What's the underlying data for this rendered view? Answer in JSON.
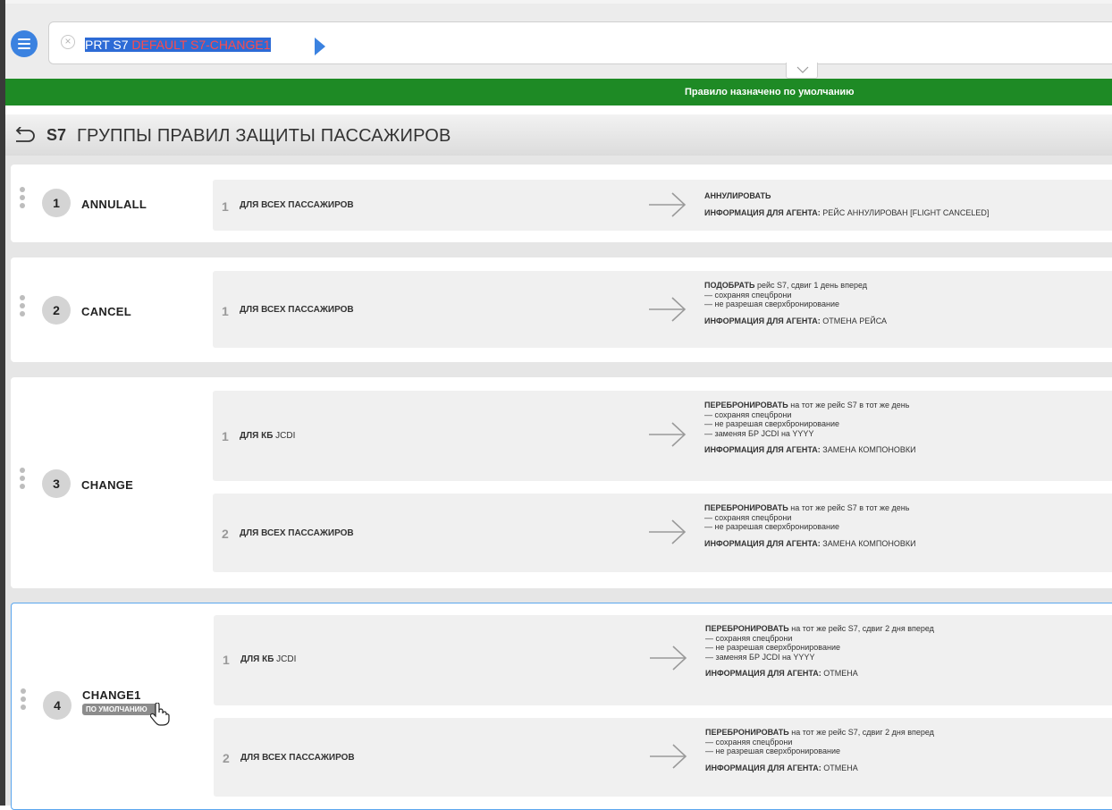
{
  "command": {
    "text_part1": "PRT S7 ",
    "text_part2": "DEFAULT S7-CHANGE1"
  },
  "notice": {
    "text": "Правило назначено по умолчанию",
    "color": "#1e8a25"
  },
  "header": {
    "code": "S7",
    "title": "ГРУППЫ ПРАВИЛ ЗАЩИТЫ ПАССАЖИРОВ"
  },
  "icons": {
    "menu": "hamburger-menu-icon",
    "clear": "clear-circle-x-icon",
    "run": "play-arrow-icon",
    "expand": "chevron-down-icon",
    "back": "back-return-icon",
    "drag": "drag-handle-icon",
    "rule_arrow": "arrow-right-icon",
    "cursor": "hand-pointer-icon"
  },
  "groups": [
    {
      "num": "1",
      "name": "ANNULALL",
      "rules": [
        {
          "num": "1",
          "cond_bold": "ДЛЯ ВСЕХ ПАССАЖИРОВ",
          "cond_sub": "",
          "action_bold": "АННУЛИРОВАТЬ",
          "action_rest": "",
          "details": [],
          "info_label": "ИНФОРМАЦИЯ ДЛЯ АГЕНТА:",
          "info_value": " РЕЙС АННУЛИРОВАН [FLIGHT CANCELED]"
        }
      ]
    },
    {
      "num": "2",
      "name": "CANCEL",
      "rules": [
        {
          "num": "1",
          "cond_bold": "ДЛЯ ВСЕХ ПАССАЖИРОВ",
          "cond_sub": "",
          "action_bold": "ПОДОБРАТЬ",
          "action_rest": " рейс S7, сдвиг 1 день вперед",
          "details": [
            "— сохраняя спецброни",
            "— не разрешая сверхбронирование"
          ],
          "info_label": "ИНФОРМАЦИЯ ДЛЯ АГЕНТА:",
          "info_value": " ОТМЕНА РЕЙСА"
        }
      ]
    },
    {
      "num": "3",
      "name": "CHANGE",
      "rules": [
        {
          "num": "1",
          "cond_bold": "ДЛЯ КБ",
          "cond_sub": " JCDI",
          "action_bold": "ПЕРЕБРОНИРОВАТЬ",
          "action_rest": " на тот же рейс S7 в тот же день",
          "details": [
            "— сохраняя спецброни",
            "— не разрешая сверхбронирование",
            "— заменяя БР JCDI на YYYY"
          ],
          "info_label": "ИНФОРМАЦИЯ ДЛЯ АГЕНТА:",
          "info_value": " ЗАМЕНА КОМПОНОВКИ"
        },
        {
          "num": "2",
          "cond_bold": "ДЛЯ ВСЕХ ПАССАЖИРОВ",
          "cond_sub": "",
          "action_bold": "ПЕРЕБРОНИРОВАТЬ",
          "action_rest": " на тот же рейс S7 в тот же день",
          "details": [
            "— сохраняя спецброни",
            "— не разрешая сверхбронирование"
          ],
          "info_label": "ИНФОРМАЦИЯ ДЛЯ АГЕНТА:",
          "info_value": " ЗАМЕНА КОМПОНОВКИ"
        }
      ]
    },
    {
      "num": "4",
      "name": "CHANGE1",
      "badge": "ПО УМОЛЧАНИЮ",
      "rules": [
        {
          "num": "1",
          "cond_bold": "ДЛЯ КБ",
          "cond_sub": " JCDI",
          "action_bold": "ПЕРЕБРОНИРОВАТЬ",
          "action_rest": " на тот же рейс S7, сдвиг 2 дня вперед",
          "details": [
            "— сохраняя спецброни",
            "— не разрешая сверхбронирование",
            "— заменяя БР JCDI на YYYY"
          ],
          "info_label": "ИНФОРМАЦИЯ ДЛЯ АГЕНТА:",
          "info_value": " ОТМЕНА"
        },
        {
          "num": "2",
          "cond_bold": "ДЛЯ ВСЕХ ПАССАЖИРОВ",
          "cond_sub": "",
          "action_bold": "ПЕРЕБРОНИРОВАТЬ",
          "action_rest": " на тот же рейс S7, сдвиг 2 дня вперед",
          "details": [
            "— сохраняя спецброни",
            "— не разрешая сверхбронирование"
          ],
          "info_label": "ИНФОРМАЦИЯ ДЛЯ АГЕНТА:",
          "info_value": " ОТМЕНА"
        }
      ]
    }
  ]
}
